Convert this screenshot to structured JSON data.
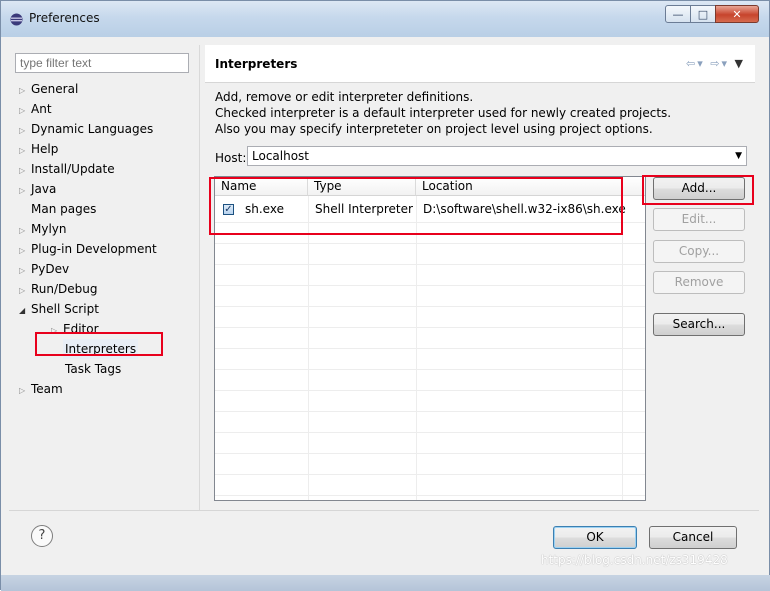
{
  "window": {
    "title": "Preferences",
    "controls": [
      "minimize",
      "maximize",
      "close"
    ]
  },
  "filter": {
    "placeholder": "type filter text"
  },
  "tree": {
    "items": [
      {
        "label": "General",
        "expander": "collapsed"
      },
      {
        "label": "Ant",
        "expander": "collapsed"
      },
      {
        "label": "Dynamic Languages",
        "expander": "collapsed"
      },
      {
        "label": "Help",
        "expander": "collapsed"
      },
      {
        "label": "Install/Update",
        "expander": "collapsed"
      },
      {
        "label": "Java",
        "expander": "collapsed"
      },
      {
        "label": "Man pages",
        "expander": "none"
      },
      {
        "label": "Mylyn",
        "expander": "collapsed"
      },
      {
        "label": "Plug-in Development",
        "expander": "collapsed"
      },
      {
        "label": "PyDev",
        "expander": "collapsed"
      },
      {
        "label": "Run/Debug",
        "expander": "collapsed"
      },
      {
        "label": "Shell Script",
        "expander": "expanded"
      },
      {
        "label": "Editor",
        "expander": "collapsed"
      },
      {
        "label": "Interpreters",
        "expander": "none",
        "selected": true
      },
      {
        "label": "Task Tags",
        "expander": "none"
      },
      {
        "label": "Team",
        "expander": "collapsed"
      }
    ]
  },
  "page": {
    "title": "Interpreters",
    "description": [
      "Add, remove or edit interpreter definitions.",
      "Checked interpreter is a default interpreter used for newly created projects.",
      "Also you may specify interpreteter on project level using project options."
    ],
    "host_label": "Host:",
    "host_value": "Localhost"
  },
  "table": {
    "columns": [
      "Name",
      "Type",
      "Location"
    ],
    "rows": [
      {
        "checked": true,
        "name": "sh.exe",
        "type": "Shell Interpreter",
        "location": "D:\\software\\shell.w32-ix86\\sh.exe"
      }
    ]
  },
  "buttons": {
    "add": "Add...",
    "edit": "Edit...",
    "copy": "Copy...",
    "remove": "Remove",
    "search": "Search...",
    "ok": "OK",
    "cancel": "Cancel",
    "help": "?"
  },
  "watermark": "https://blog.csdn.net/zs319428",
  "highlight_color": "#e8001c"
}
